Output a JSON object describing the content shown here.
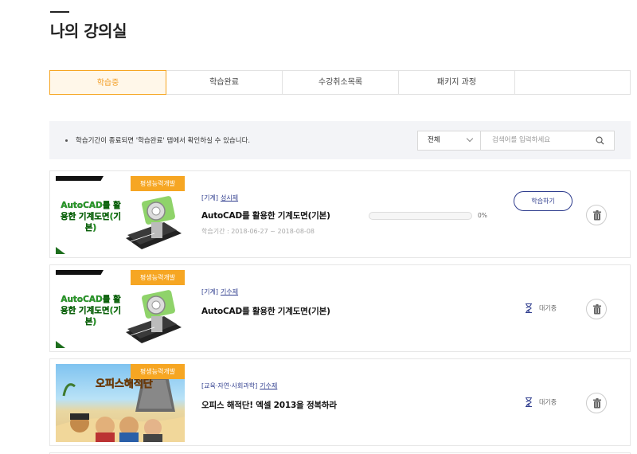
{
  "page": {
    "title": "나의 강의실"
  },
  "tabs": [
    {
      "label": "학습중",
      "active": true
    },
    {
      "label": "학습완료",
      "active": false
    },
    {
      "label": "수강취소목록",
      "active": false
    },
    {
      "label": "패키지 과정",
      "active": false
    },
    {
      "label": "",
      "active": false
    }
  ],
  "notice": {
    "text": "학습기간이 종료되면 '학습완료' 탭에서 확인하실 수 있습니다.",
    "filter": {
      "selected": "전체"
    },
    "search": {
      "placeholder": "검색어를 입력하세요",
      "icon": "search-icon"
    }
  },
  "courses": [
    {
      "badge": "평생능력개발",
      "thumb_text": "AutoCAD를 활용한 기계도면(기본)",
      "category": "[기계]",
      "instructor": "성시제",
      "title": "AutoCAD를 활용한 기계도면(기본)",
      "period": "학습기간 : 2018-06-27 ~ 2018-08-08",
      "progress": 0,
      "progress_label": "0%",
      "action_label": "학습하기",
      "status": "active"
    },
    {
      "badge": "평생능력개발",
      "thumb_text": "AutoCAD를 활용한 기계도면(기본)",
      "category": "[기계]",
      "instructor": "기수제",
      "title": "AutoCAD를 활용한 기계도면(기본)",
      "wait_label": "대기중",
      "status": "waiting"
    },
    {
      "badge": "평생능력개발",
      "thumb_text": "오피스해적단",
      "category": "[교육·자연·사회과학]",
      "instructor": "기수제",
      "title": "오피스 해적단! 엑셀 2013을 정복하라",
      "wait_label": "대기중",
      "status": "waiting"
    }
  ],
  "colors": {
    "accent": "#f6a623",
    "navy": "#2f3d8e",
    "notice_bg": "#f3f4f7"
  }
}
